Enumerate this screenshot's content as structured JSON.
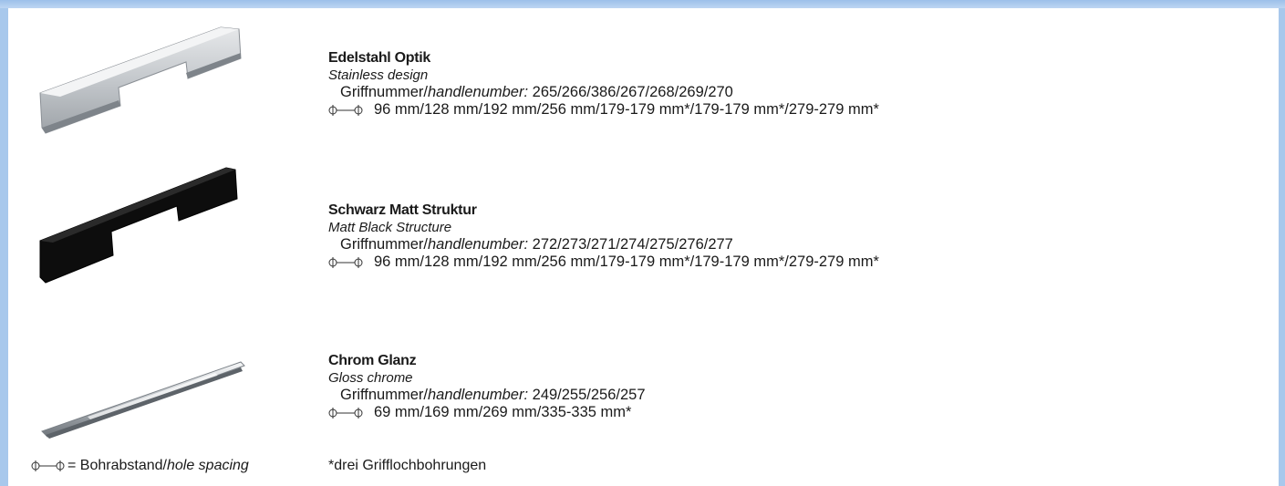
{
  "products": [
    {
      "name": "Edelstahl Optik",
      "subtitle": "Stainless design",
      "number_label": "Griffnummer/",
      "number_label_en": "handlenumber:",
      "numbers": "265/266/386/267/268/269/270",
      "dimensions": "96 mm/128 mm/192 mm/256 mm/179-179 mm*/179-179 mm*/279-279 mm*",
      "finish": "stainless"
    },
    {
      "name": "Schwarz Matt Struktur",
      "subtitle": "Matt Black Structure",
      "number_label": "Griffnummer/",
      "number_label_en": "handlenumber:",
      "numbers": "272/273/271/274/275/276/277",
      "dimensions": "96 mm/128 mm/192 mm/256 mm/179-179 mm*/179-179 mm*/279-279 mm*",
      "finish": "black"
    },
    {
      "name": "Chrom Glanz",
      "subtitle": "Gloss chrome",
      "number_label": "Griffnummer/",
      "number_label_en": "handlenumber:",
      "numbers": "249/255/256/257",
      "dimensions": "69 mm/169 mm/269 mm/335-335 mm*",
      "finish": "chrome"
    }
  ],
  "footer": {
    "legend_prefix": "= Bohrabstand/",
    "legend_en": "hole spacing",
    "note": "*drei Grifflochbohrungen"
  },
  "icons": {
    "hole_spacing": "hole-spacing-icon"
  },
  "colors": {
    "frame": "#a8c8ec"
  }
}
